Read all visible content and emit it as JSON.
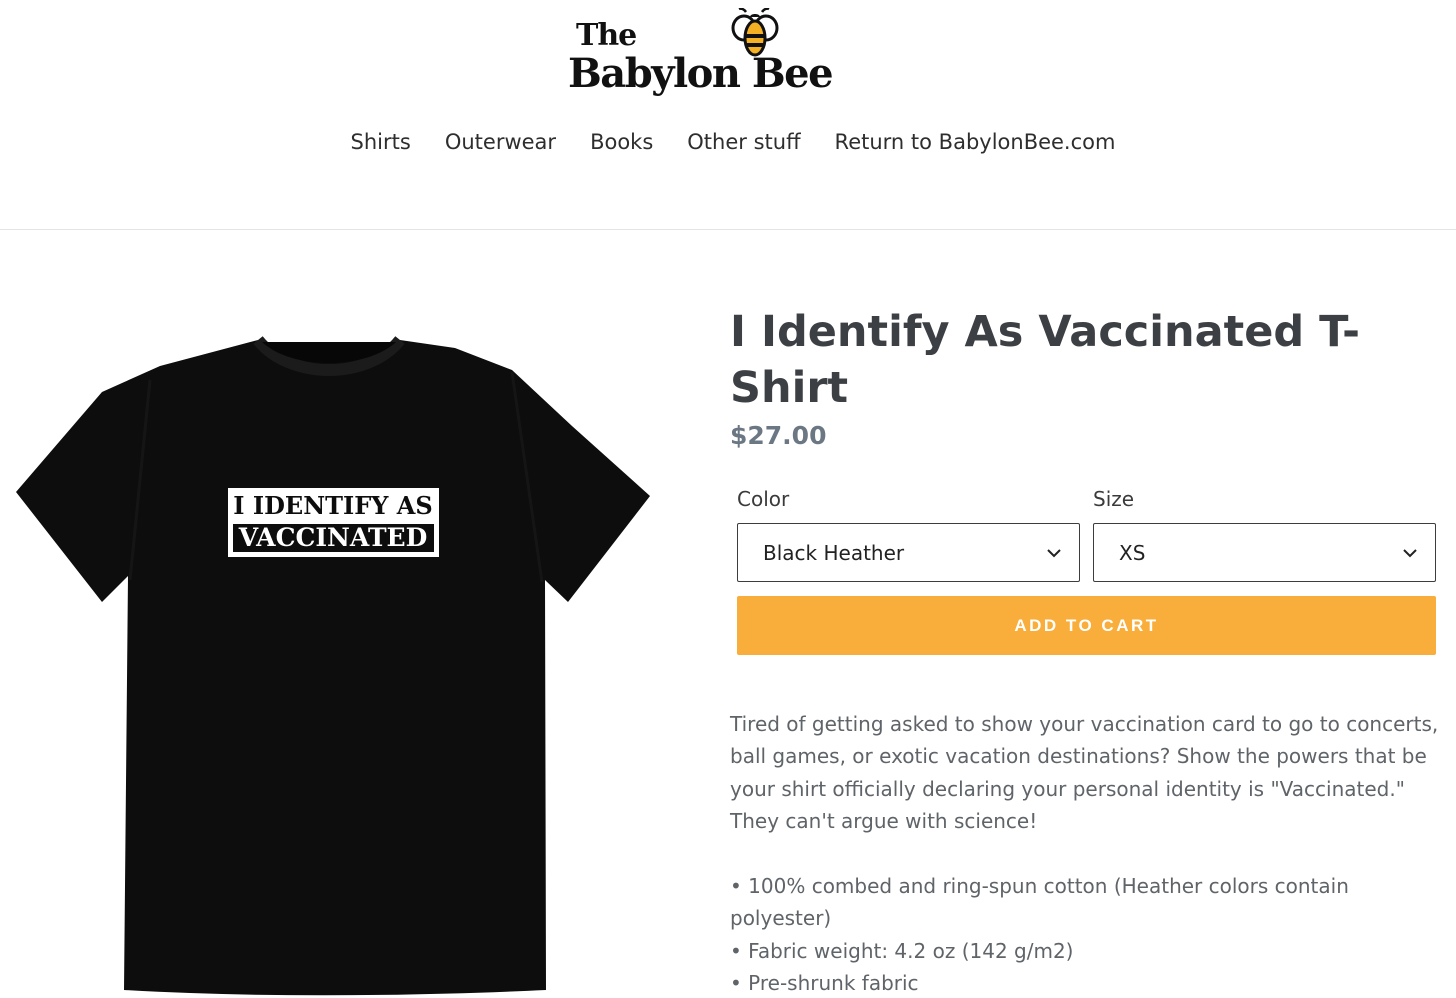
{
  "header": {
    "logo": {
      "line1": "The",
      "line2": "Babylon Bee",
      "icon": "bee-icon"
    },
    "nav": [
      {
        "label": "Shirts"
      },
      {
        "label": "Outerwear"
      },
      {
        "label": "Books"
      },
      {
        "label": "Other stuff"
      },
      {
        "label": "Return to BabylonBee.com"
      }
    ]
  },
  "product": {
    "title": "I Identify As Vaccinated T-Shirt",
    "price": "$27.00",
    "image": {
      "print_line1": "I IDENTIFY AS",
      "print_line2": "VACCINATED",
      "shirt_color": "#0d0d0d"
    },
    "options": {
      "color": {
        "label": "Color",
        "value": "Black Heather"
      },
      "size": {
        "label": "Size",
        "value": "XS"
      }
    },
    "add_to_cart_label": "ADD TO CART",
    "description": "Tired of getting asked to show your vaccination card to go to concerts, ball games, or exotic vacation destinations? Show the powers that be your shirt officially declaring your personal identity is \"Vaccinated.\" They can't argue with science!",
    "features": [
      "100% combed and ring-spun cotton (Heather colors contain polyester)",
      "Fabric weight: 4.2 oz (142 g/m2)",
      "Pre-shrunk fabric"
    ]
  },
  "colors": {
    "accent": "#f9ae3b",
    "text": "#3c3f43",
    "price": "#6b7782",
    "bee_yellow": "#f6b024"
  }
}
